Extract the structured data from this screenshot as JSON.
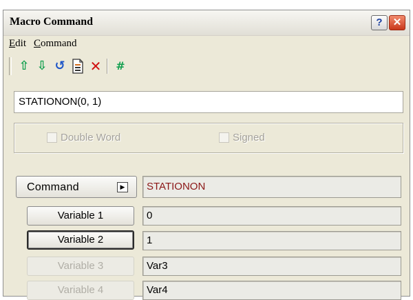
{
  "window": {
    "title": "Macro Command",
    "help_glyph": "?",
    "close_glyph": "✕"
  },
  "menu": {
    "items": [
      {
        "label": "Edit"
      },
      {
        "label": "Command"
      }
    ]
  },
  "toolbar": {
    "icons": {
      "move_up": "⇧",
      "move_down": "⇩",
      "undo": "↺",
      "properties": "🗎",
      "delete": "✕",
      "hash": "#"
    }
  },
  "expression": {
    "value": "STATIONON(0, 1)"
  },
  "options": {
    "double_word_label": "Double Word",
    "signed_label": "Signed",
    "double_word_checked": false,
    "signed_checked": false
  },
  "command": {
    "button_label": "Command",
    "dropdown_glyph": "▶",
    "value": "STATIONON",
    "value_color": "#8b1616"
  },
  "variables": [
    {
      "label": "Variable 1",
      "value": "0",
      "enabled": true
    },
    {
      "label": "Variable 2",
      "value": "1",
      "enabled": true,
      "focused": true
    },
    {
      "label": "Variable 3",
      "value": "Var3",
      "enabled": false
    },
    {
      "label": "Variable 4",
      "value": "Var4",
      "enabled": false
    }
  ]
}
